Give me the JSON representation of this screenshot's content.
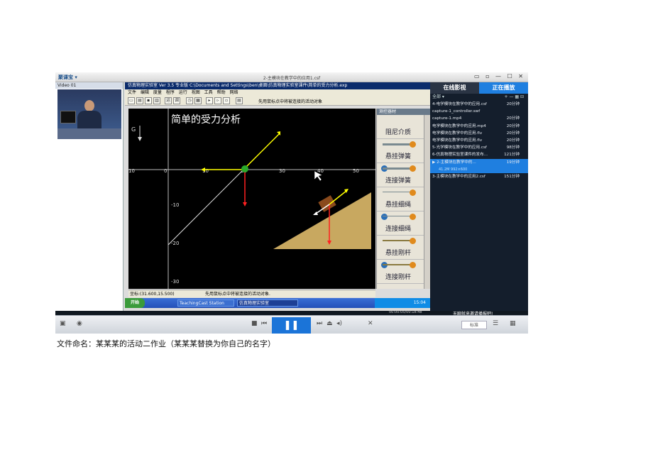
{
  "window": {
    "title": "2-主模块在教学中的应用1.csf",
    "app_logo": "聚课宝 ▾",
    "controls": "▭ ▫ — ☐ ✕"
  },
  "left_pane": {
    "video_label": "Video 01"
  },
  "sim_app": {
    "titlebar": "仿真物理实验室  Ver 3.5 专业版   C:\\Documents and Settings\\ben\\桌面\\仿真物理实验室课件\\简单的受力分析.exp",
    "menu": [
      "文件",
      "编辑",
      "度量",
      "程序",
      "运行",
      "视图",
      "工具",
      "帮助",
      "网络"
    ],
    "toolbar_buttons": [
      "运",
      "调"
    ],
    "hint": "先用鼠标点中将被连接的活动对象",
    "canvas_title": "简单的受力分析",
    "g_label": "G",
    "axis_x_labels": [
      "10",
      "0",
      "10",
      "20",
      "30",
      "40",
      "50"
    ],
    "axis_y_labels": [
      "-10",
      "-20",
      "-30"
    ],
    "status_coord": "坐标:(31.600,15.500)",
    "status_hint": "先用鼠标点中将被连接的活动对象."
  },
  "palette": {
    "header": "测控器材",
    "items": [
      "阻尼介质",
      "悬挂弹簧",
      "连接弹簧",
      "悬挂细绳",
      "连接细绳",
      "悬挂刚杆",
      "连接刚杆"
    ]
  },
  "taskbar": {
    "start": "开始",
    "tasks": [
      "TeachingCast Station",
      "仿真物理实验室"
    ],
    "clock": "15:04"
  },
  "right_pane": {
    "tabs": [
      "在线影视",
      "正在播放"
    ],
    "list_header": "全部 ▾",
    "list_actions": "+ — ▦ ⊟",
    "playlist": [
      {
        "name": "4-电学模块在教学中的应用.csf",
        "duration": "20分钟"
      },
      {
        "name": "capture-1_controller.swf",
        "duration": ""
      },
      {
        "name": "capture-1.mp4",
        "duration": "20分钟"
      },
      {
        "name": "电学模块在教学中的应用.mp4",
        "duration": "20分钟"
      },
      {
        "name": "电学模块在教学中的应用.flv",
        "duration": "20分钟"
      },
      {
        "name": "电学模块在教学中的应用.flv",
        "duration": "20分钟"
      },
      {
        "name": "5-光学模块在教学中的应用.csf",
        "duration": "98分钟"
      },
      {
        "name": "6-仿真物理实验室课件的发布...",
        "duration": "121分钟"
      },
      {
        "name": "2-主模块在教学中的...",
        "duration": "19分钟",
        "selected": true,
        "sub": "41.2M   992×600"
      },
      {
        "name": "3-主模块在教学中的应用2.csf",
        "duration": "151分钟"
      }
    ]
  },
  "player": {
    "time": "00:00:05/00:18:48",
    "right_text": "无聊就来邀请播报吧!",
    "speed": "标准",
    "play_icon": "pause-icon"
  },
  "caption": "文件命名：某某某的活动二作业（某某某替换为你自己的名字）"
}
